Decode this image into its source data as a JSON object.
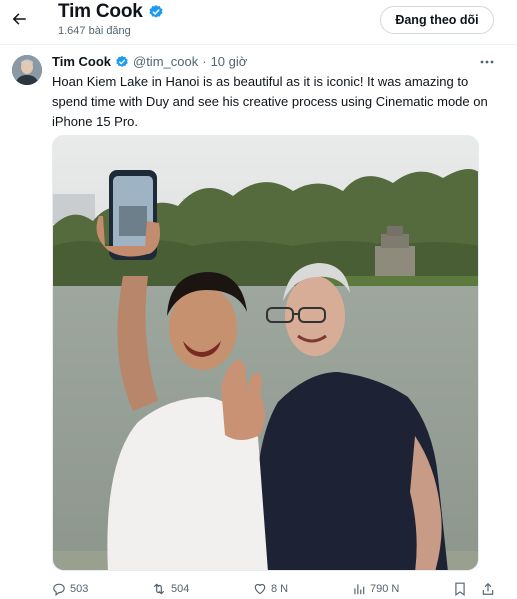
{
  "header": {
    "name": "Tim Cook",
    "post_count": "1.647 bài đăng",
    "follow_label": "Đang theo dõi"
  },
  "tweet": {
    "author_name": "Tim Cook",
    "handle": "@tim_cook",
    "separator": "·",
    "time": "10 giờ",
    "text": "Hoan Kiem Lake in Hanoi is as beautiful as it is iconic! It was amazing to spend time with Duy and see his creative process using Cinematic mode on iPhone 15 Pro."
  },
  "actions": {
    "replies": "503",
    "reposts": "504",
    "likes": "8 N",
    "views": "790 N"
  },
  "icons": {
    "back": "arrow-left-icon",
    "verified": "verified-badge-icon",
    "more": "more-horizontal-icon",
    "reply": "reply-icon",
    "repost": "repost-icon",
    "like": "heart-icon",
    "views": "views-chart-icon",
    "bookmark": "bookmark-icon",
    "share": "share-icon"
  },
  "colors": {
    "verified": "#1d9bf0",
    "text": "#0f1419",
    "secondary": "#536471",
    "border": "#cfd9de"
  }
}
